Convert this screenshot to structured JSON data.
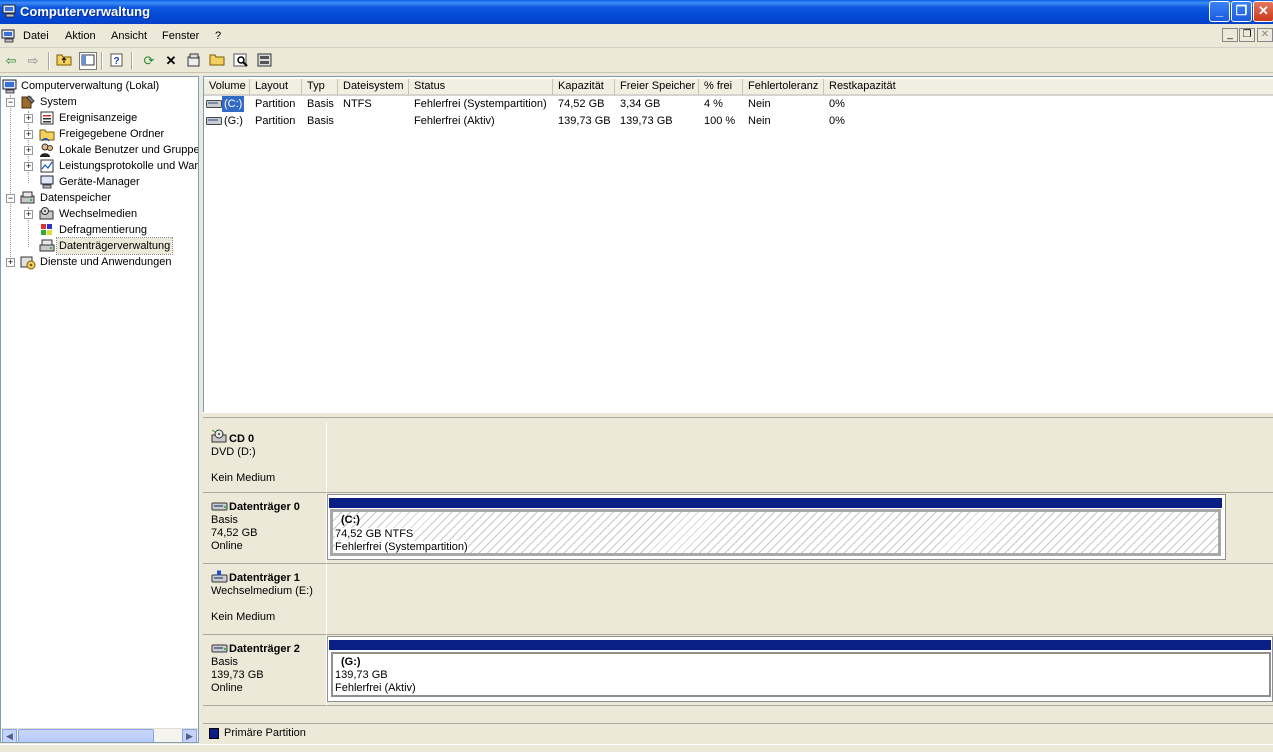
{
  "window": {
    "title": "Computerverwaltung",
    "minimize": "_",
    "restore": "❐",
    "close": "✕"
  },
  "menu": {
    "items": [
      "Datei",
      "Aktion",
      "Ansicht",
      "Fenster",
      "?"
    ],
    "mdi_min": "_",
    "mdi_restore": "❐",
    "mdi_close": "✕"
  },
  "tree": {
    "root": "Computerverwaltung (Lokal)",
    "system": "System",
    "ereignis": "Ereignisanzeige",
    "freigegeben": "Freigegebene Ordner",
    "benutzer": "Lokale Benutzer und Gruppen",
    "leistung": "Leistungsprotokolle und Warn",
    "geraete": "Geräte-Manager",
    "datenspeicher": "Datenspeicher",
    "wechsel": "Wechselmedien",
    "defrag": "Defragmentierung",
    "dtv": "Datenträgerverwaltung",
    "dienste": "Dienste und Anwendungen"
  },
  "list": {
    "headers": [
      "Volume",
      "Layout",
      "Typ",
      "Dateisystem",
      "Status",
      "Kapazität",
      "Freier Speicher",
      "% frei",
      "Fehlertoleranz",
      "Restkapazität"
    ],
    "rows": [
      [
        "(C:)",
        "Partition",
        "Basis",
        "NTFS",
        "Fehlerfrei (Systempartition)",
        "74,52 GB",
        "3,34 GB",
        "4 %",
        "Nein",
        "0%"
      ],
      [
        "(G:)",
        "Partition",
        "Basis",
        "",
        "Fehlerfrei (Aktiv)",
        "139,73 GB",
        "139,73 GB",
        "100 %",
        "Nein",
        "0%"
      ]
    ]
  },
  "disks": {
    "cd0": {
      "name": "CD 0",
      "line1": "DVD (D:)",
      "line2": "Kein Medium"
    },
    "d0": {
      "name": "Datenträger 0",
      "line1": "Basis",
      "line2": "74,52 GB",
      "line3": "Online",
      "part_title": "(C:)",
      "part_line1": "74,52 GB NTFS",
      "part_line2": "Fehlerfrei (Systempartition)"
    },
    "d1": {
      "name": "Datenträger 1",
      "line1": "Wechselmedium (E:)",
      "line2": "Kein Medium"
    },
    "d2": {
      "name": "Datenträger 2",
      "line1": "Basis",
      "line2": "139,73 GB",
      "line3": "Online",
      "part_title": "(G:)",
      "part_line1": "139,73 GB",
      "part_line2": "Fehlerfrei (Aktiv)"
    }
  },
  "legend": {
    "label": "Primäre Partition",
    "color": "#0a1f86"
  }
}
